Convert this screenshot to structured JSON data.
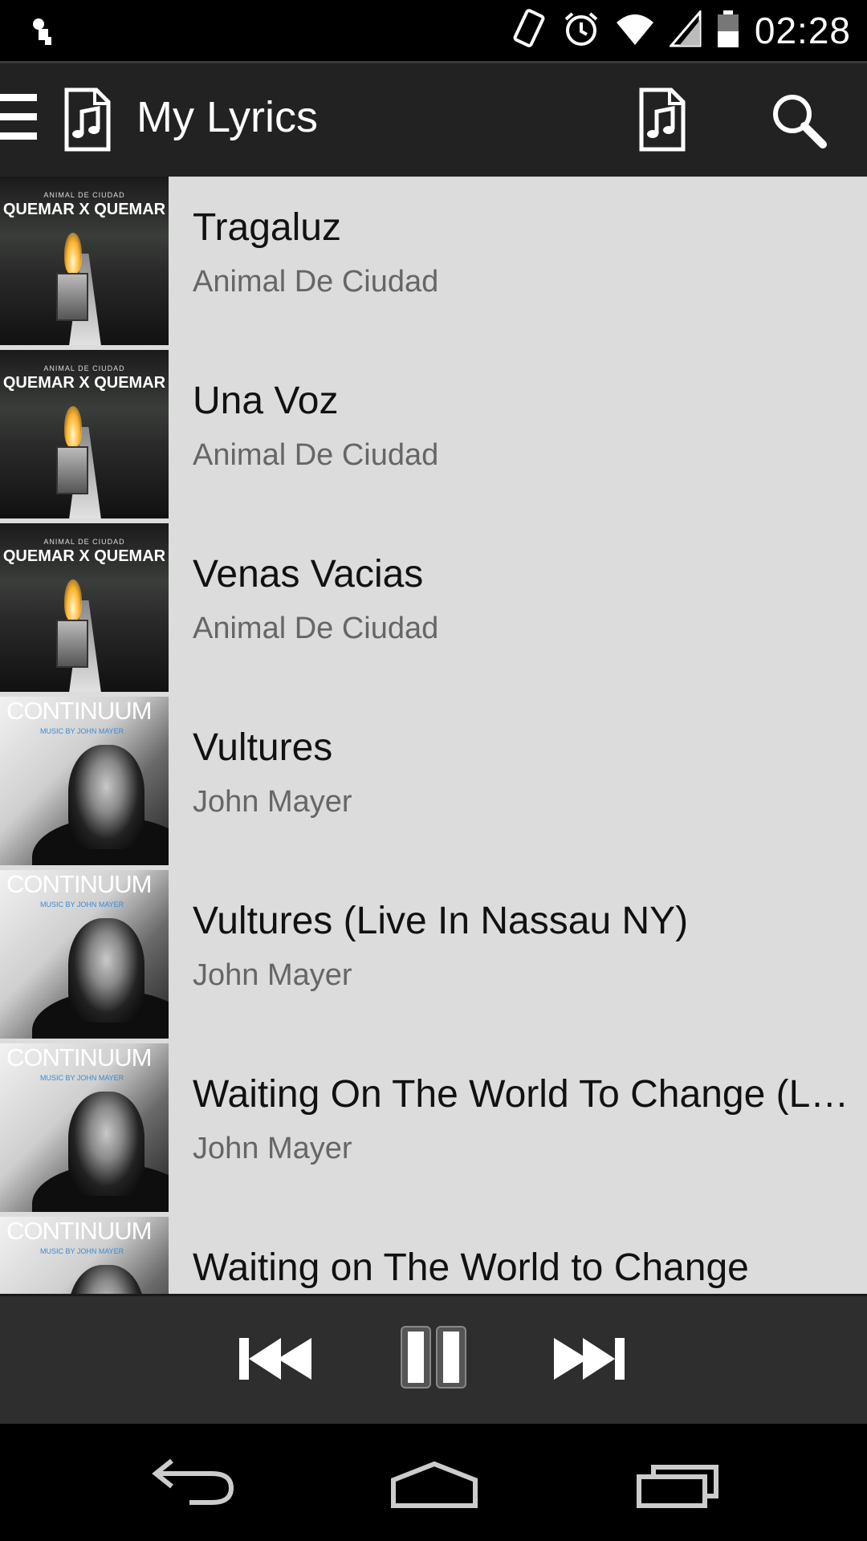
{
  "status_bar": {
    "time": "02:28",
    "icons": [
      "notification-icon",
      "vibrate-icon",
      "alarm-icon",
      "wifi-icon",
      "signal-icon",
      "battery-icon"
    ]
  },
  "action_bar": {
    "title": "My Lyrics",
    "icons": [
      "menu-icon",
      "music-file-icon",
      "lyrics-file-icon",
      "search-icon"
    ]
  },
  "songs": [
    {
      "title": "Tragaluz",
      "artist": "Animal De Ciudad",
      "album": "qxq"
    },
    {
      "title": "Una Voz",
      "artist": "Animal De Ciudad",
      "album": "qxq"
    },
    {
      "title": "Venas Vacias",
      "artist": "Animal De Ciudad",
      "album": "qxq"
    },
    {
      "title": "Vultures",
      "artist": "John Mayer",
      "album": "cont"
    },
    {
      "title": "Vultures (Live In Nassau NY)",
      "artist": "John Mayer",
      "album": "cont"
    },
    {
      "title": "Waiting On The World To Change (Liv…",
      "artist": "John Mayer",
      "album": "cont"
    },
    {
      "title": "Waiting on The World to Change",
      "artist": "",
      "album": "cont"
    }
  ],
  "album_art": {
    "qxq": {
      "small": "ANIMAL DE CIUDAD",
      "big": "QUEMAR X QUEMAR"
    },
    "cont": {
      "title": "CONTINUUM",
      "subtitle": "MUSIC BY JOHN MAYER"
    }
  },
  "player": {
    "controls": [
      "previous-icon",
      "pause-icon",
      "next-icon"
    ]
  },
  "nav_bar": {
    "buttons": [
      "back-icon",
      "home-icon",
      "recents-icon"
    ]
  },
  "colors": {
    "action_bar": "#222222",
    "list_bg": "#dcdcdc",
    "player_bg": "#2e2e2e"
  }
}
